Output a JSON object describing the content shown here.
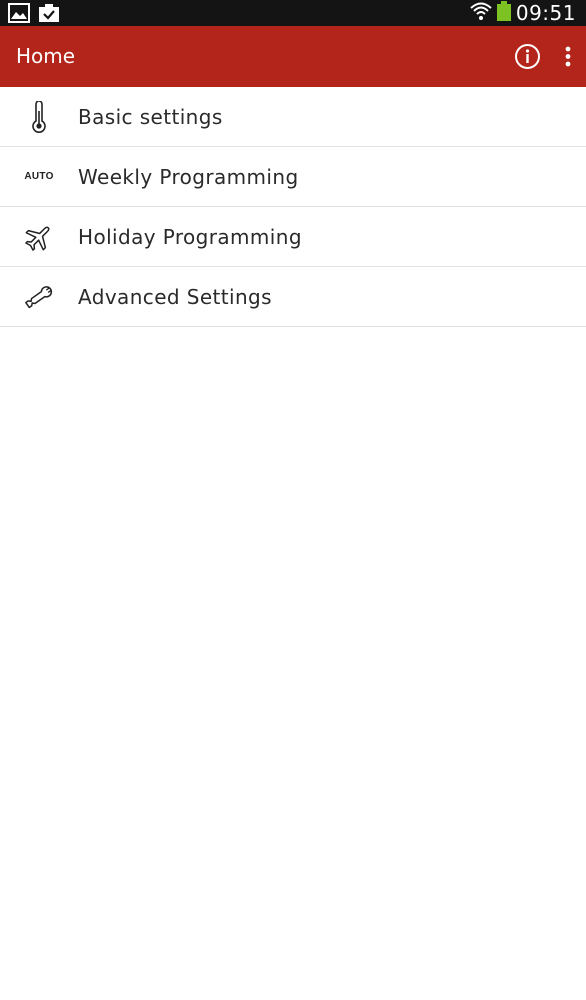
{
  "status_bar": {
    "time": "09:51",
    "left_icons": [
      "gallery-icon",
      "clipboard-check-icon"
    ],
    "right_icons": [
      "wifi-icon",
      "battery-icon"
    ]
  },
  "app_bar": {
    "title": "Home",
    "background_color": "#b3251a",
    "actions": [
      "info-icon",
      "overflow-menu-icon"
    ]
  },
  "menu": {
    "items": [
      {
        "label": "Basic settings",
        "icon": "thermometer-icon"
      },
      {
        "label": "Weekly Programming",
        "icon": "auto-icon",
        "icon_text": "AUTO"
      },
      {
        "label": "Holiday Programming",
        "icon": "airplane-icon"
      },
      {
        "label": "Advanced Settings",
        "icon": "wrench-icon"
      }
    ]
  }
}
